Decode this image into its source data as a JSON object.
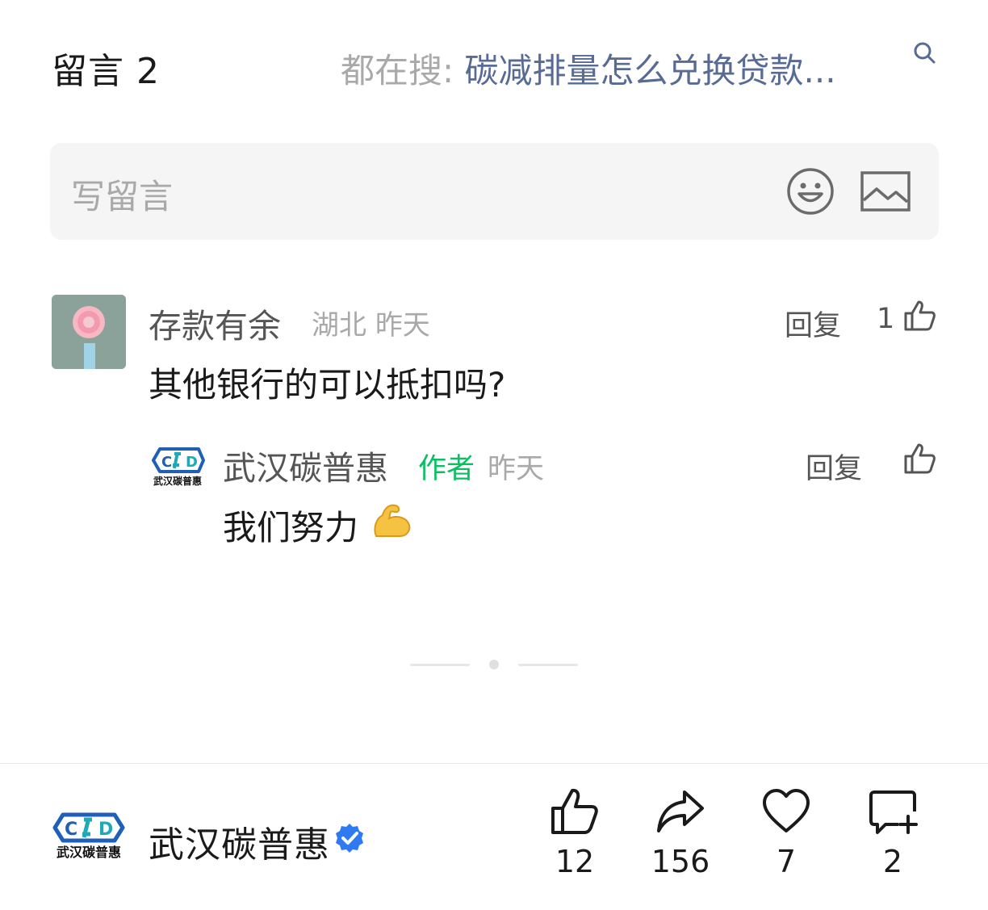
{
  "header": {
    "comments_label": "留言 2",
    "search_prefix": "都在搜:",
    "search_query": "碳减排量怎么兑换贷款..."
  },
  "write_box": {
    "placeholder": "写留言"
  },
  "comments": [
    {
      "author": "存款有余",
      "location": "湖北",
      "time": "昨天",
      "reply_label": "回复",
      "likes": "1",
      "text": "其他银行的可以抵扣吗?",
      "replies": [
        {
          "author": "武汉碳普惠",
          "badge": "作者",
          "time": "昨天",
          "reply_label": "回复",
          "text": "我们努力",
          "emoji": "flexed-biceps"
        }
      ]
    }
  ],
  "logo": {
    "text": "武汉碳普惠",
    "mark_colors": [
      "#1f5fb8",
      "#1fa9b7"
    ]
  },
  "footer": {
    "account_name": "武汉碳普惠",
    "verified_color": "#2f7af2",
    "actions": [
      {
        "icon": "thumb-up-icon",
        "count": "12"
      },
      {
        "icon": "share-icon",
        "count": "156"
      },
      {
        "icon": "heart-icon",
        "count": "7"
      },
      {
        "icon": "comment-add-icon",
        "count": "2"
      }
    ]
  }
}
